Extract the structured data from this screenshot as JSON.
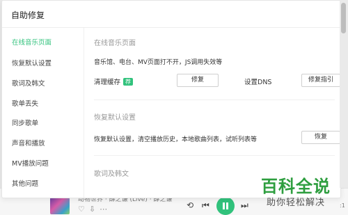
{
  "dialog": {
    "title": "自助修复"
  },
  "nav": {
    "items": [
      {
        "label": "在线音乐页面",
        "active": true
      },
      {
        "label": "恢复默认设置",
        "active": false
      },
      {
        "label": "歌词及韩文",
        "active": false
      },
      {
        "label": "歌单丢失",
        "active": false
      },
      {
        "label": "同步歌单",
        "active": false
      },
      {
        "label": "声音和播放",
        "active": false
      },
      {
        "label": "MV播放问题",
        "active": false
      },
      {
        "label": "其他问题",
        "active": false
      }
    ]
  },
  "sections": {
    "online": {
      "heading": "在线音乐页面",
      "description": "音乐馆、电台、MV页面打不开，JS调用失效等",
      "clear_cache_label": "清理缓存",
      "badge": "荐",
      "repair_button": "修复",
      "dns_label": "设置DNS",
      "dns_button": "修复指引"
    },
    "restore": {
      "heading": "恢复默认设置",
      "description": "恢复默认设置，清空播放历史，本地歌曲列表，试听列表等",
      "restore_button": "恢复"
    },
    "lyrics": {
      "heading": "歌词及韩文"
    }
  },
  "player": {
    "song_line": "动物世界 · 薛之谦 (Live) · 薛之谦",
    "time_edge": ":1"
  },
  "watermark": {
    "main": "百科全说",
    "sub": "助你轻松解决"
  },
  "colors": {
    "accent": "#31c27c",
    "watermark_green": "#2e9e3f"
  }
}
